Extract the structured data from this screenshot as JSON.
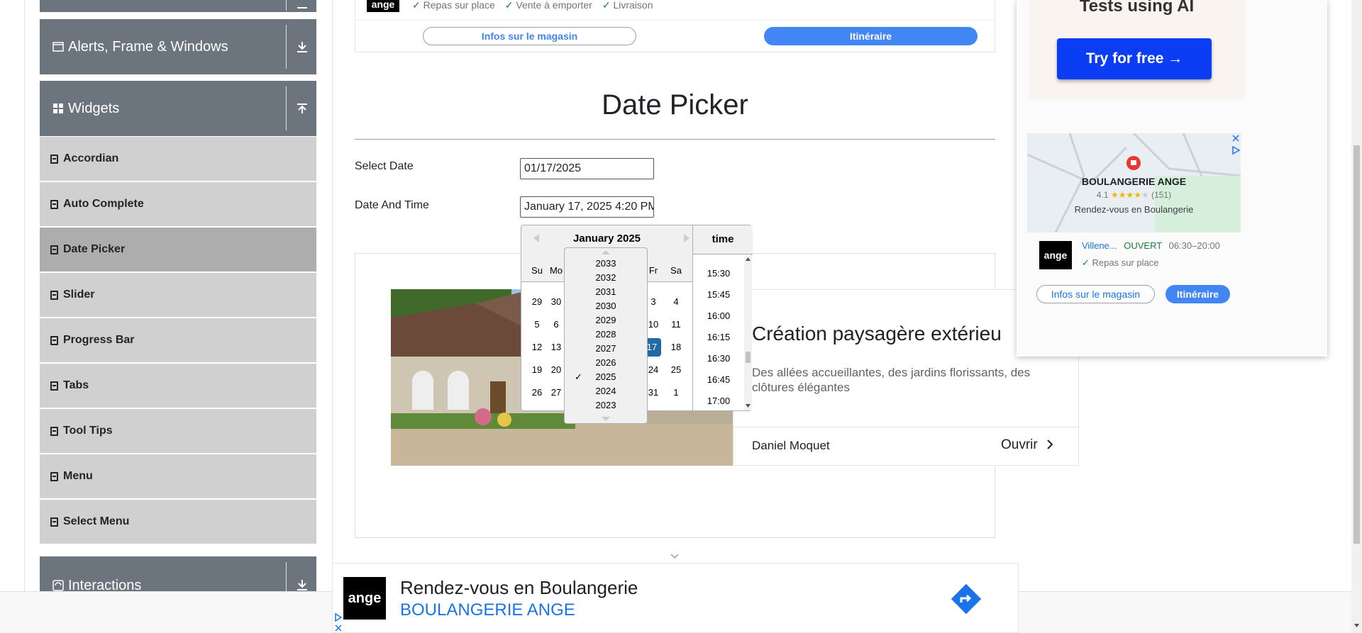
{
  "sidebar": {
    "groups": [
      {
        "label": "Alerts, Frame & Windows"
      },
      {
        "label": "Widgets"
      },
      {
        "label": "Interactions"
      }
    ],
    "items": [
      {
        "label": "Accordian"
      },
      {
        "label": "Auto Complete"
      },
      {
        "label": "Date Picker"
      },
      {
        "label": "Slider"
      },
      {
        "label": "Progress Bar"
      },
      {
        "label": "Tabs"
      },
      {
        "label": "Tool Tips"
      },
      {
        "label": "Menu"
      },
      {
        "label": "Select Menu"
      }
    ]
  },
  "top_store": {
    "logo": "ange",
    "features": [
      "Repas sur place",
      "Vente à emporter",
      "Livraison"
    ],
    "info_button": "Infos sur le magasin",
    "route_button": "Itinéraire"
  },
  "page": {
    "title": "Date Picker",
    "select_date_label": "Select Date",
    "select_date_value": "01/17/2025",
    "date_time_label": "Date And Time",
    "date_time_value": "January 17, 2025 4:20 PM"
  },
  "datepicker": {
    "month_label": "January 2025",
    "time_header": "time",
    "weekdays": [
      "Su",
      "Mo",
      "Fr",
      "Sa"
    ],
    "rows": [
      {
        "su": "29",
        "mo": "30",
        "fr": "3",
        "sa": "4"
      },
      {
        "su": "5",
        "mo": "6",
        "fr": "10",
        "sa": "11"
      },
      {
        "su": "12",
        "mo": "13",
        "fr": "17",
        "sa": "18"
      },
      {
        "su": "19",
        "mo": "20",
        "fr": "24",
        "sa": "25"
      },
      {
        "su": "26",
        "mo": "27",
        "fr": "31",
        "sa": "1"
      }
    ],
    "selected_day": "17",
    "years": [
      "2033",
      "2032",
      "2031",
      "2030",
      "2029",
      "2028",
      "2027",
      "2026",
      "2025",
      "2024",
      "2023"
    ],
    "selected_year": "2025",
    "check_mark": "✓",
    "times": [
      "15:30",
      "15:45",
      "16:00",
      "16:15",
      "16:30",
      "16:45",
      "17:00"
    ]
  },
  "ad_main": {
    "title": "Création paysagère extérieu",
    "description": "Des allées accueillantes, des jardins florissants, des clôtures élégantes",
    "advertiser": "Daniel Moquet",
    "cta": "Ouvrir"
  },
  "side_ad": {
    "headline": "Tests using AI",
    "cta": "Try for free →",
    "map_name": "BOULANGERIE ANGE",
    "rating": "4.1",
    "rating_stars": 4.1,
    "review_count": "(151)",
    "map_tagline": "Rendez-vous en Boulangerie",
    "logo": "ange",
    "location": "Villene...",
    "status": "OUVERT",
    "hours": "06:30–20:00",
    "feature": "Repas sur place",
    "info_button": "Infos sur le magasin",
    "route_button": "Itinéraire"
  },
  "bottom_ad": {
    "logo": "ange",
    "headline": "Rendez-vous en Boulangerie",
    "brand": "BOULANGERIE ANGE"
  },
  "colors": {
    "sidebar_group": "#6c757d",
    "sidebar_item": "#d0d0d0",
    "sidebar_item_active": "#adadad",
    "accent_blue": "#4285f4",
    "datepicker_selected": "#216ba5",
    "try_button": "#0b3df5",
    "open_green": "#188038"
  }
}
